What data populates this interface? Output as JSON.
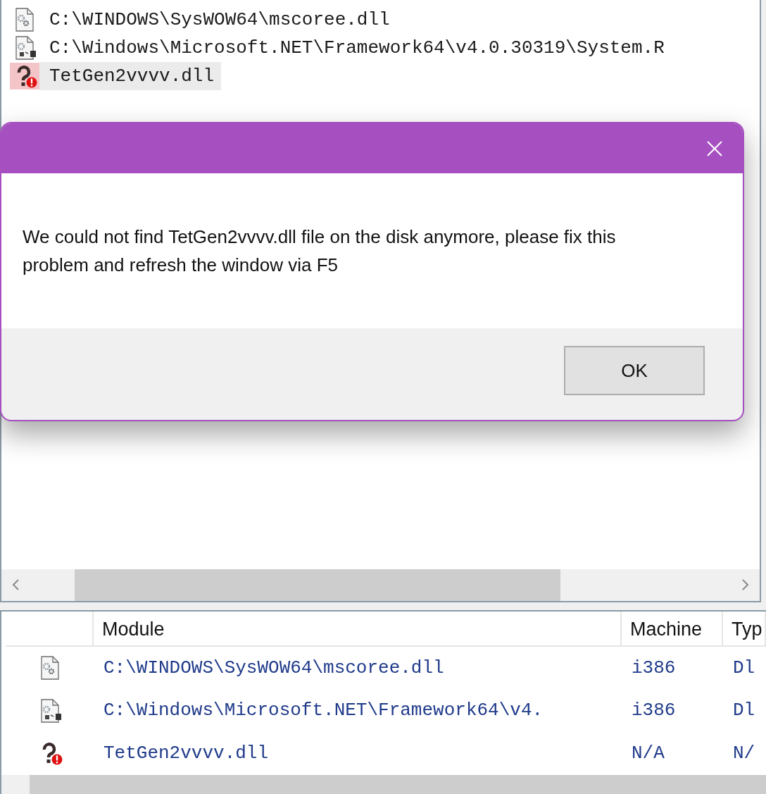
{
  "tree": {
    "items": [
      {
        "kind": "dll",
        "label": "C:\\WINDOWS\\SysWOW64\\mscoree.dll",
        "selected": false
      },
      {
        "kind": "managed",
        "label": "C:\\Windows\\Microsoft.NET\\Framework64\\v4.0.30319\\System.R",
        "selected": false
      },
      {
        "kind": "missing",
        "label": "TetGen2vvvv.dll",
        "selected": true
      }
    ]
  },
  "dialog": {
    "message": "We could not find TetGen2vvvv.dll file on the disk anymore, please fix this problem and refresh the window via F5",
    "button": "OK"
  },
  "modules": {
    "columns": [
      "Module",
      "Machine",
      "Typ"
    ],
    "rows": [
      {
        "kind": "dll",
        "module": "C:\\WINDOWS\\SysWOW64\\mscoree.dll",
        "machine": "i386",
        "type": "Dl"
      },
      {
        "kind": "managed",
        "module": "C:\\Windows\\Microsoft.NET\\Framework64\\v4.",
        "machine": "i386",
        "type": "Dl"
      },
      {
        "kind": "missing",
        "module": "TetGen2vvvv.dll",
        "machine": "N/A",
        "type": "N/"
      }
    ]
  }
}
